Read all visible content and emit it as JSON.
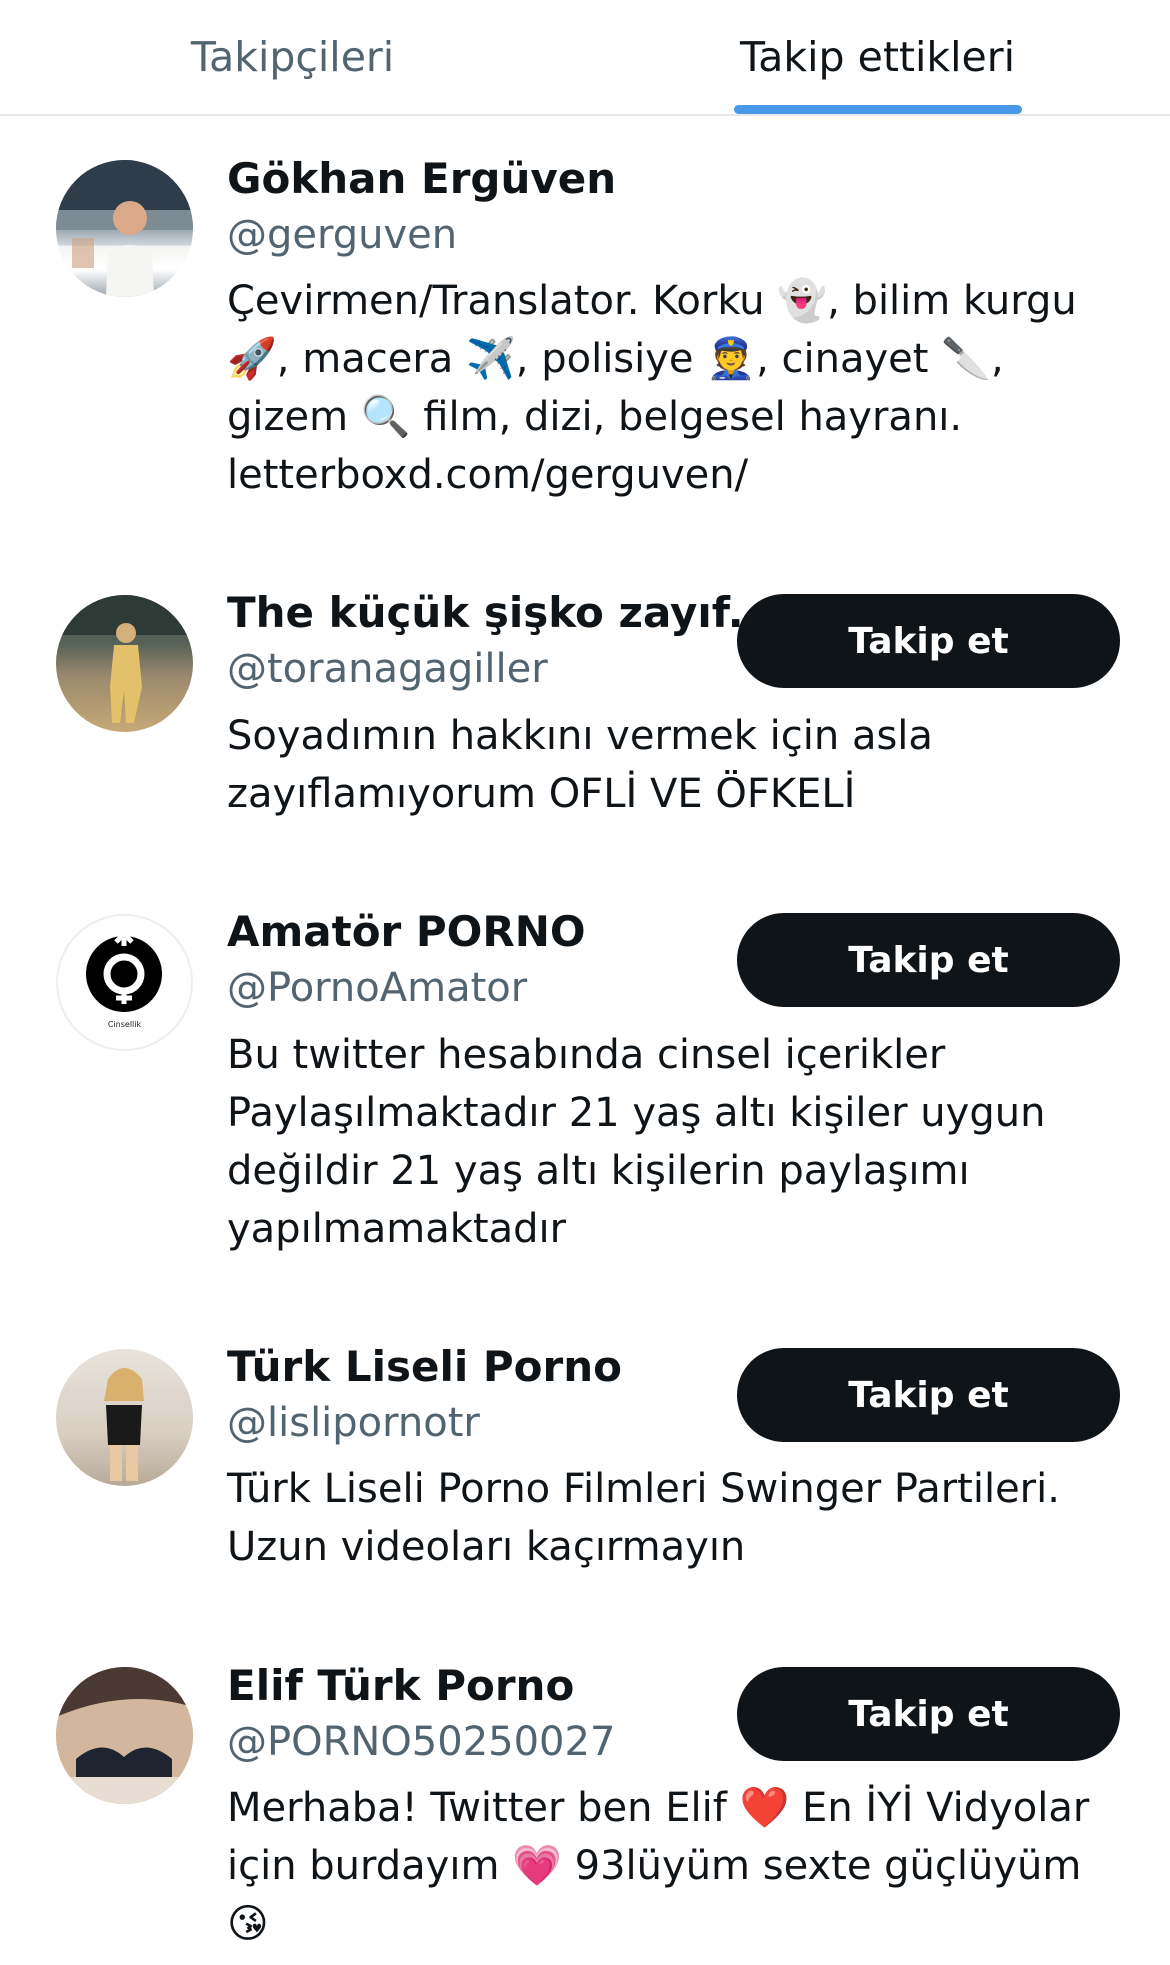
{
  "tabs": {
    "followers": "Takipçileri",
    "following": "Takip ettikleri",
    "active": "following"
  },
  "accent_color": "#4a99e9",
  "users": [
    {
      "name": "Gökhan Ergüven",
      "handle": "@gerguven",
      "bio": [
        "Çevirmen/Translator. Korku 👻, bilim kurgu",
        "🚀, macera ✈️, polisiye 👮, cinayet 🔪,",
        "gizem 🔍 film, dizi, belgesel hayranı.",
        "letterboxd.com/gerguven/"
      ],
      "button": ""
    },
    {
      "name": "The küçük şişko zayıf...",
      "handle": "@toranagagiller",
      "bio": [
        "Soyadımın hakkını vermek için asla",
        "zayıflamıyorum OFLİ VE ÖFKELİ"
      ],
      "button": "Takip et"
    },
    {
      "name": "Amatör PORNO",
      "handle": "@PornoAmator",
      "bio": [
        "Bu twitter hesabında cinsel içerikler",
        "Paylaşılmaktadır 21 yaş altı kişiler uygun",
        "değildir 21 yaş altı kişilerin paylaşımı",
        "yapılmamaktadır"
      ],
      "button": "Takip et",
      "avatar_label": "Cinsellik"
    },
    {
      "name": "Türk Liseli Porno",
      "handle": "@lislipornotr",
      "bio": [
        "Türk Liseli Porno Filmleri Swinger Partileri.",
        "Uzun videoları kaçırmayın"
      ],
      "button": "Takip et"
    },
    {
      "name": "Elif Türk Porno",
      "handle": "@PORNO50250027",
      "bio": [
        "Merhaba! Twitter ben Elif ❤️ En İYİ Vidyolar",
        "için burdayım 💗 93lüyüm sexte güçlüyüm",
        "😘"
      ],
      "button": "Takip et"
    }
  ]
}
